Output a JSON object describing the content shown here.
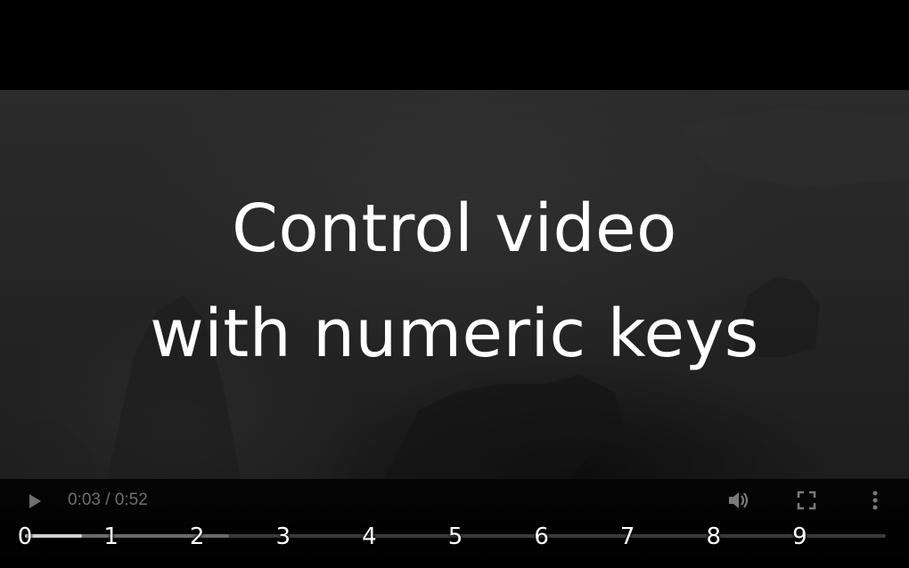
{
  "overlay": {
    "line1": "Control video",
    "line2": "with numeric keys"
  },
  "controls": {
    "play_icon": "play-icon",
    "current_time": "0:03",
    "separator": "/",
    "duration": "0:52",
    "volume_icon": "volume-icon",
    "fullscreen_icon": "fullscreen-icon",
    "more_icon": "more-vertical-icon"
  },
  "progress": {
    "played_fraction": 0.066,
    "buffered_fraction": 0.237
  },
  "key_markers": [
    "0",
    "1",
    "2",
    "3",
    "4",
    "5",
    "6",
    "7",
    "8",
    "9"
  ],
  "colors": {
    "caption": "#ffffff",
    "time_text": "#6f6f6f",
    "progress_played": "#cfcfcf",
    "progress_buffered": "#6b6b6b",
    "progress_track": "#3a3a3a"
  }
}
